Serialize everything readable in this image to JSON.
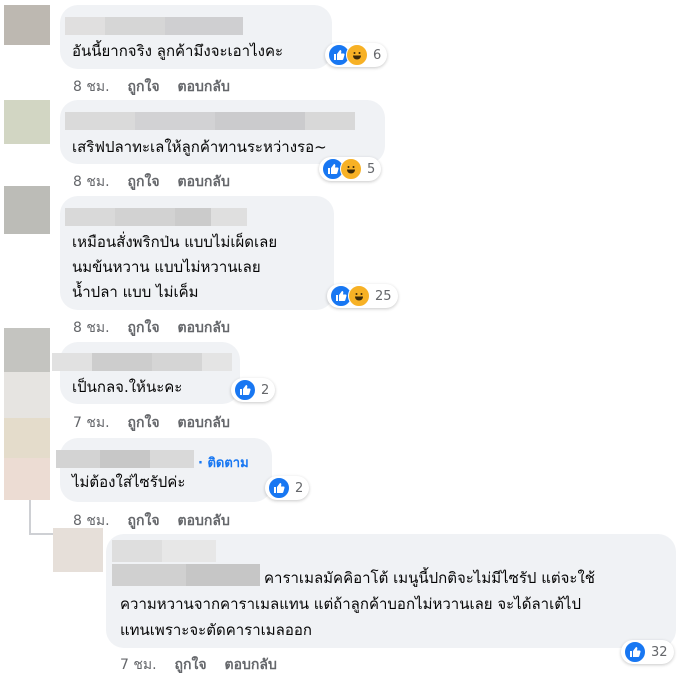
{
  "comments": [
    {
      "text_lines": [
        "อันนี้ยากจริง ลูกค้ามึงจะเอาไงคะ"
      ],
      "reactions": [
        "like",
        "haha"
      ],
      "count": "6",
      "time": "8 ชม.",
      "like_label": "ถูกใจ",
      "reply_label": "ตอบกลับ"
    },
    {
      "text_lines": [
        "เสริฟปลาทะเลให้ลูกค้าทานระหว่างรอ~"
      ],
      "reactions": [
        "like",
        "haha"
      ],
      "count": "5",
      "time": "8 ชม.",
      "like_label": "ถูกใจ",
      "reply_label": "ตอบกลับ"
    },
    {
      "text_lines": [
        "เหมือนสั่งพริกป่น แบบไม่เผ็ดเลย",
        "นมข้นหวาน แบบไม่หวานเลย",
        "น้ำปลา แบบ ไม่เค็ม"
      ],
      "reactions": [
        "like",
        "haha"
      ],
      "count": "25",
      "time": "8 ชม.",
      "like_label": "ถูกใจ",
      "reply_label": "ตอบกลับ"
    },
    {
      "text_lines": [
        "เป็นกลจ.ให้นะคะ"
      ],
      "reactions": [
        "like"
      ],
      "count": "2",
      "time": "7 ชม.",
      "like_label": "ถูกใจ",
      "reply_label": "ตอบกลับ"
    },
    {
      "follow_label": "· ติดตาม",
      "text_lines": [
        "ไม่ต้องใส่ไซรัปค่ะ"
      ],
      "reactions": [
        "like"
      ],
      "count": "2",
      "time": "8 ชม.",
      "like_label": "ถูกใจ",
      "reply_label": "ตอบกลับ"
    }
  ],
  "reply": {
    "text_lines": [
      "คาราเมลมัคคิอาโต้ เมนูนี้ปกติจะไม่มีไซรัป แต่จะใช้",
      "ความหวานจากคาราเมลแทน แต่ถ้าลูกค้าบอกไม่หวานเลย จะได้ลาเต้ไป",
      "แทนเพราะจะตัดคาราเมลออก"
    ],
    "reactions": [
      "like"
    ],
    "count": "32",
    "time": "7 ชม.",
    "like_label": "ถูกใจ",
    "reply_label": "ตอบกลับ"
  },
  "colors": {
    "bubble": "#f0f2f5",
    "like": "#1877f2",
    "haha": "#f7b125",
    "meta": "#65676b",
    "link": "#1877f2"
  }
}
